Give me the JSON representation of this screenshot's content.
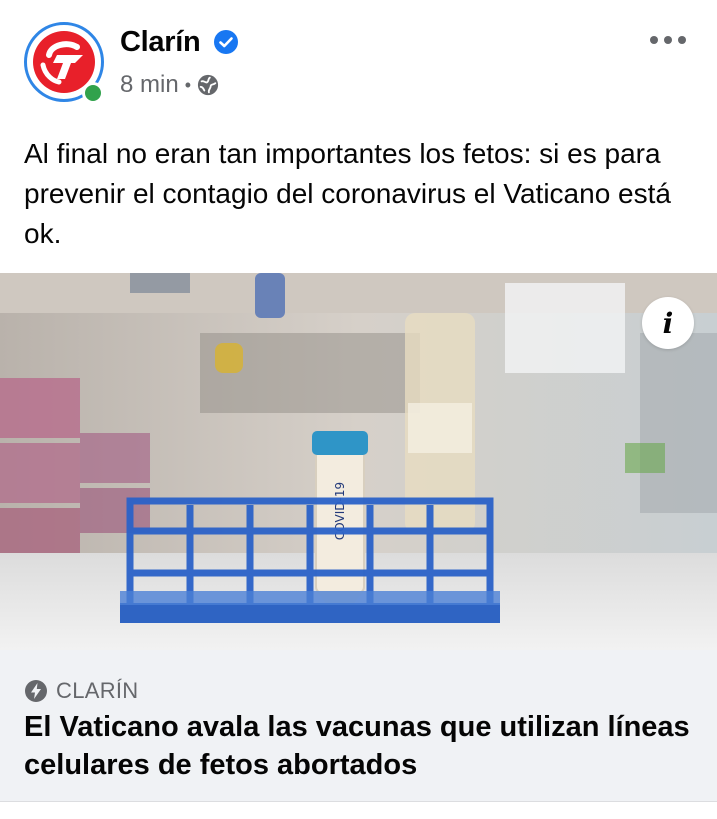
{
  "post": {
    "page_name": "Clarín",
    "verified": true,
    "timestamp": "8 min",
    "separator": "•",
    "audience_icon": "globe-icon",
    "more_icon": "more-horizontal-icon",
    "text": "Al final no eran tan importantes los fetos: si es para prevenir el contagio del coronavirus el Vaticano está ok."
  },
  "link_preview": {
    "image_subject": "laboratory-test-tube-in-rack",
    "tube_label": "COVID-19",
    "info_icon": "info-icon",
    "source_icon": "bolt-icon",
    "source": "CLARÍN",
    "title": "El Vaticano avala las vacunas que utilizan líneas celulares de fetos abortados"
  },
  "colors": {
    "verified_blue": "#1877f2",
    "online_green": "#31a24c",
    "brand_red": "#e8202a",
    "footer_bg": "#f0f2f5",
    "secondary_text": "#65676b"
  }
}
